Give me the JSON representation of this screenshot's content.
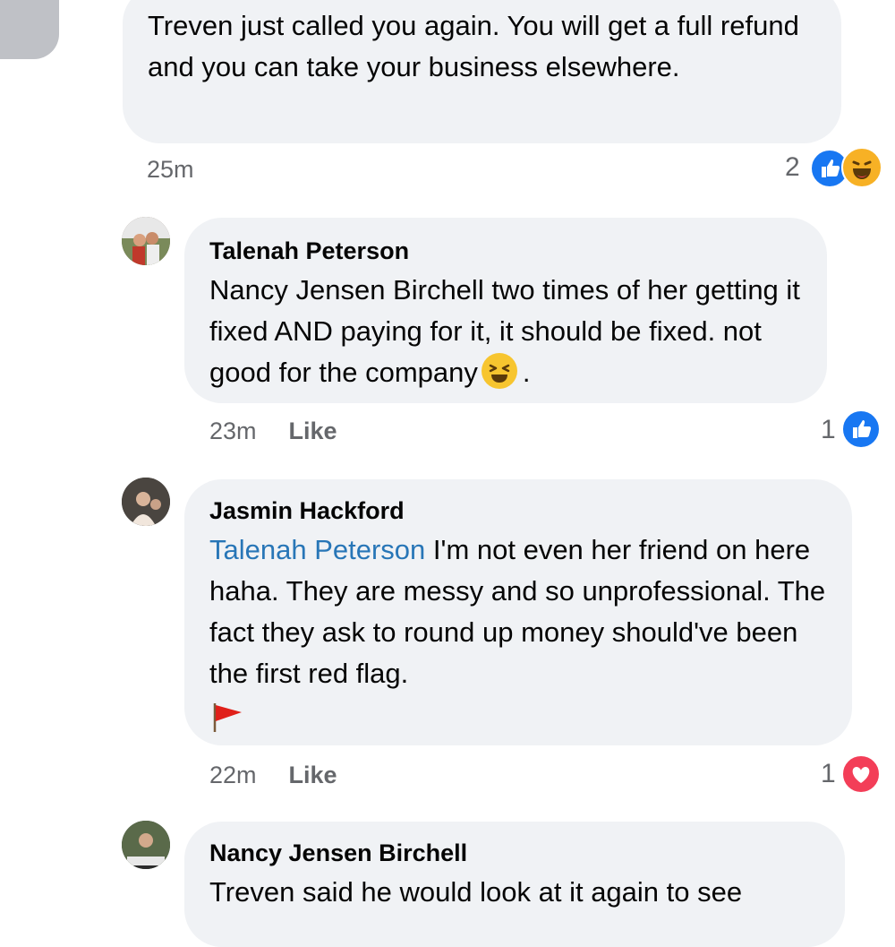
{
  "comments": [
    {
      "text": "Treven just called you again. You will get a full refund and you can take your business elsewhere.",
      "time": "25m",
      "reaction_count": "2",
      "reactions": [
        "like-icon",
        "haha-icon"
      ]
    },
    {
      "author": "Talenah Peterson",
      "text": "Nancy Jensen Birchell two times of her getting it fixed AND paying for it, it should be fixed. not good for the company",
      "text_end": ".",
      "time": "23m",
      "like_label": "Like",
      "reaction_count": "1",
      "reactions": [
        "like-icon"
      ]
    },
    {
      "author": "Jasmin Hackford",
      "mention": "Talenah Peterson",
      "text": "I'm not even her friend on here haha. They are messy and so unprofessional. The fact they ask to round up money should've been the first red flag.",
      "time": "22m",
      "like_label": "Like",
      "reaction_count": "1",
      "reactions": [
        "love-icon"
      ]
    },
    {
      "author": "Nancy Jensen Birchell",
      "text": "Treven said he would look at it again to see"
    }
  ],
  "colors": {
    "bubble": "#f0f2f5",
    "mention": "#2876b7",
    "like": "#1877f2",
    "love": "#f33e58",
    "meta": "#65676b"
  }
}
